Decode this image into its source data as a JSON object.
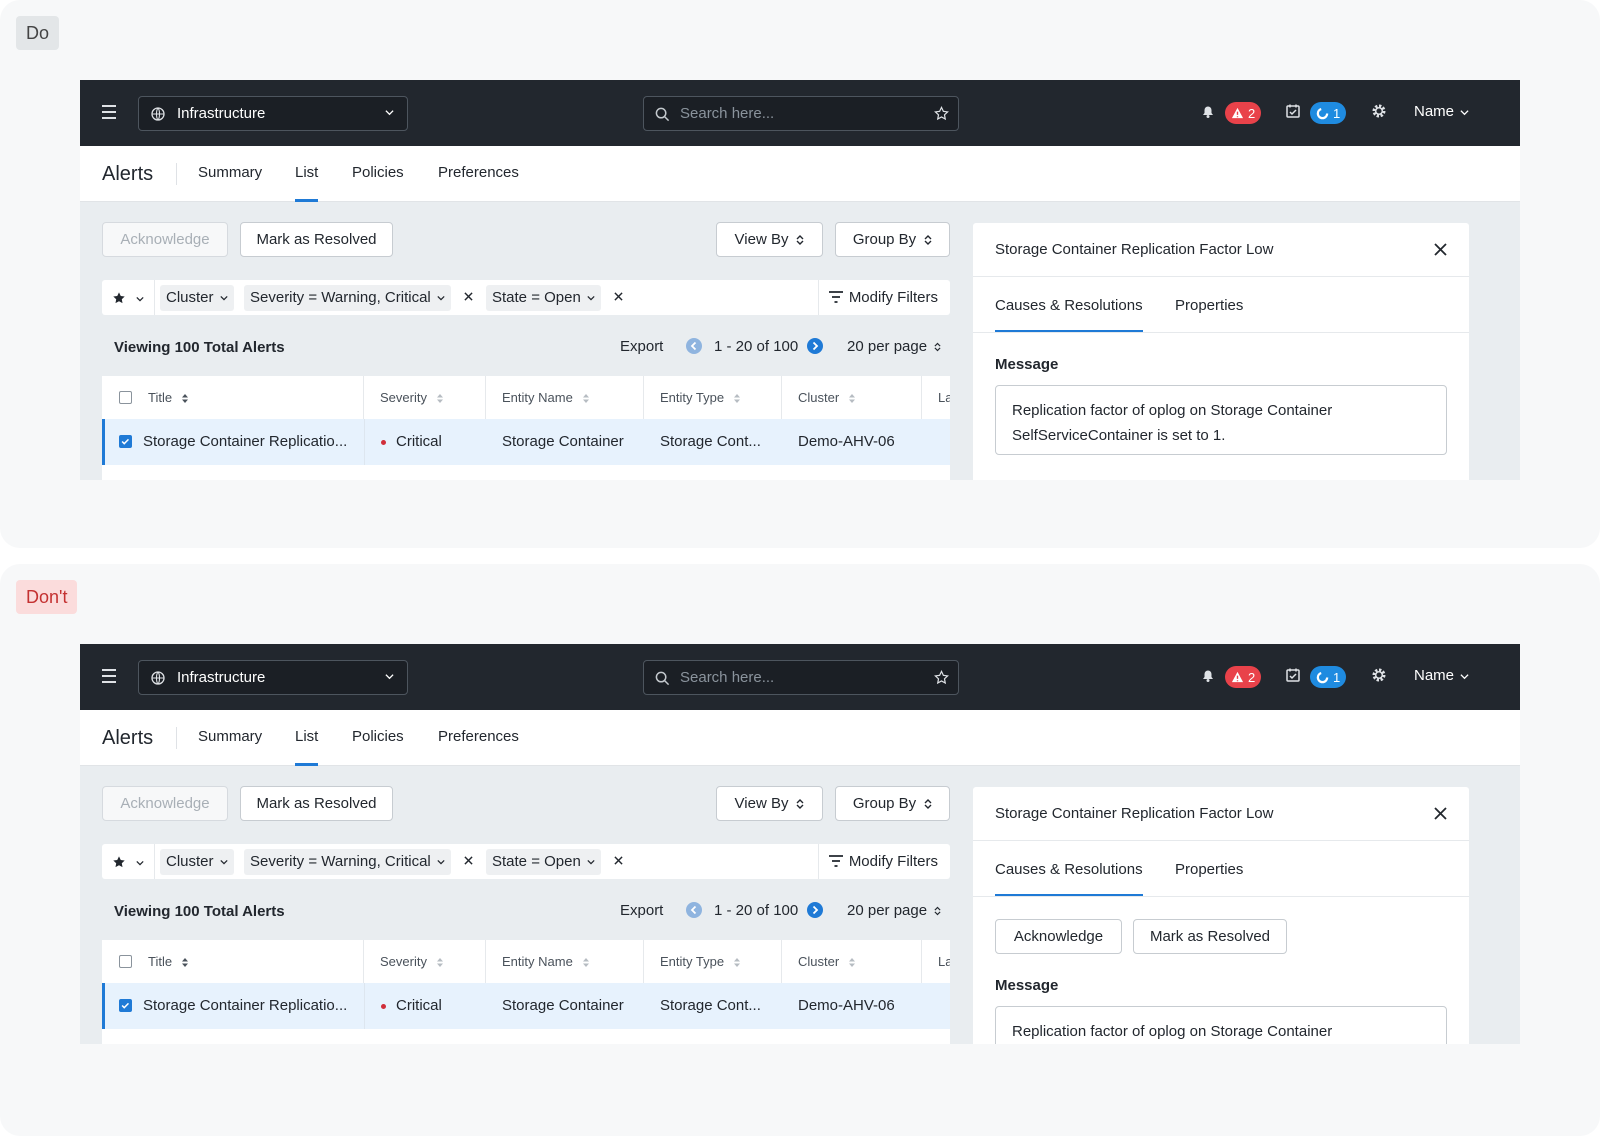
{
  "examples": [
    {
      "tag": "Do",
      "tag_style": "do",
      "panel_actions": false
    },
    {
      "tag": "Don't",
      "tag_style": "dont",
      "panel_actions": true
    }
  ],
  "topbar": {
    "app_name": "Infrastructure",
    "search_placeholder": "Search here...",
    "alert_count": "2",
    "task_count": "1",
    "user_name": "Name"
  },
  "subnav": {
    "title": "Alerts",
    "tabs": [
      "Summary",
      "List",
      "Policies",
      "Preferences"
    ],
    "active_tab": "List"
  },
  "toolbar": {
    "acknowledge": "Acknowledge",
    "mark_resolved": "Mark as Resolved",
    "view_by": "View By",
    "group_by": "Group By"
  },
  "filters": {
    "chips": [
      "Cluster",
      "Severity = Warning, Critical",
      "State = Open"
    ],
    "modify": "Modify Filters"
  },
  "list": {
    "viewing": "Viewing 100 Total Alerts",
    "export": "Export",
    "range": "1 - 20 of 100",
    "per_page": "20 per page"
  },
  "table": {
    "headers": [
      "Title",
      "Severity",
      "Entity Name",
      "Entity Type",
      "Cluster",
      "La"
    ],
    "row": [
      "Storage Container Replicatio...",
      "Critical",
      "Storage Container",
      "Storage Cont...",
      "Demo-AHV-06"
    ]
  },
  "panel": {
    "title": "Storage Container Replication Factor Low",
    "tabs": [
      "Causes & Resolutions",
      "Properties"
    ],
    "message_label": "Message",
    "message": "Replication factor of oplog on Storage Container SelfServiceContainer is set to 1.",
    "acknowledge": "Acknowledge",
    "mark_resolved": "Mark as Resolved"
  },
  "colors": {
    "topbar": "#22272e",
    "accent": "#1f7ad6",
    "alert_badge": "#e9424a",
    "task_badge": "#1f8be0",
    "critical": "#d02e3a"
  }
}
